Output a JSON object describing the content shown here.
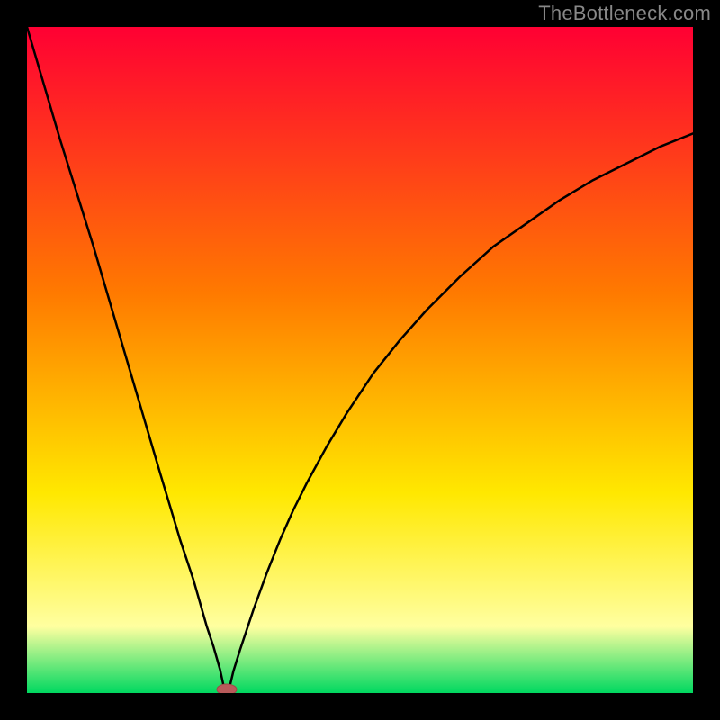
{
  "watermark": "TheBottleneck.com",
  "colors": {
    "frame": "#000000",
    "gradient_top": "#ff0033",
    "gradient_mid1": "#ff7a00",
    "gradient_mid2": "#ffe800",
    "gradient_low": "#ffffa0",
    "gradient_bottom": "#00d860",
    "curve": "#000000",
    "marker_fill": "#b85a5a",
    "marker_stroke": "#a04848"
  },
  "chart_data": {
    "type": "line",
    "title": "",
    "xlabel": "",
    "ylabel": "",
    "xlim": [
      0,
      100
    ],
    "ylim": [
      0,
      100
    ],
    "minimum_marker": {
      "x": 30,
      "y": 0
    },
    "series": [
      {
        "name": "bottleneck-curve",
        "x": [
          0,
          5,
          10,
          15,
          20,
          23,
          25,
          27,
          28,
          29,
          29.5,
          30,
          30.5,
          31,
          32,
          34,
          36,
          38,
          40,
          42,
          45,
          48,
          52,
          56,
          60,
          65,
          70,
          75,
          80,
          85,
          90,
          95,
          100
        ],
        "values": [
          100,
          83,
          67,
          50,
          33,
          23,
          17,
          10,
          7,
          3.5,
          1.2,
          0,
          1.2,
          3.3,
          6.5,
          12.5,
          18,
          23,
          27.5,
          31.5,
          37,
          42,
          48,
          53,
          57.5,
          62.5,
          67,
          70.5,
          74,
          77,
          79.5,
          82,
          84
        ]
      }
    ]
  }
}
